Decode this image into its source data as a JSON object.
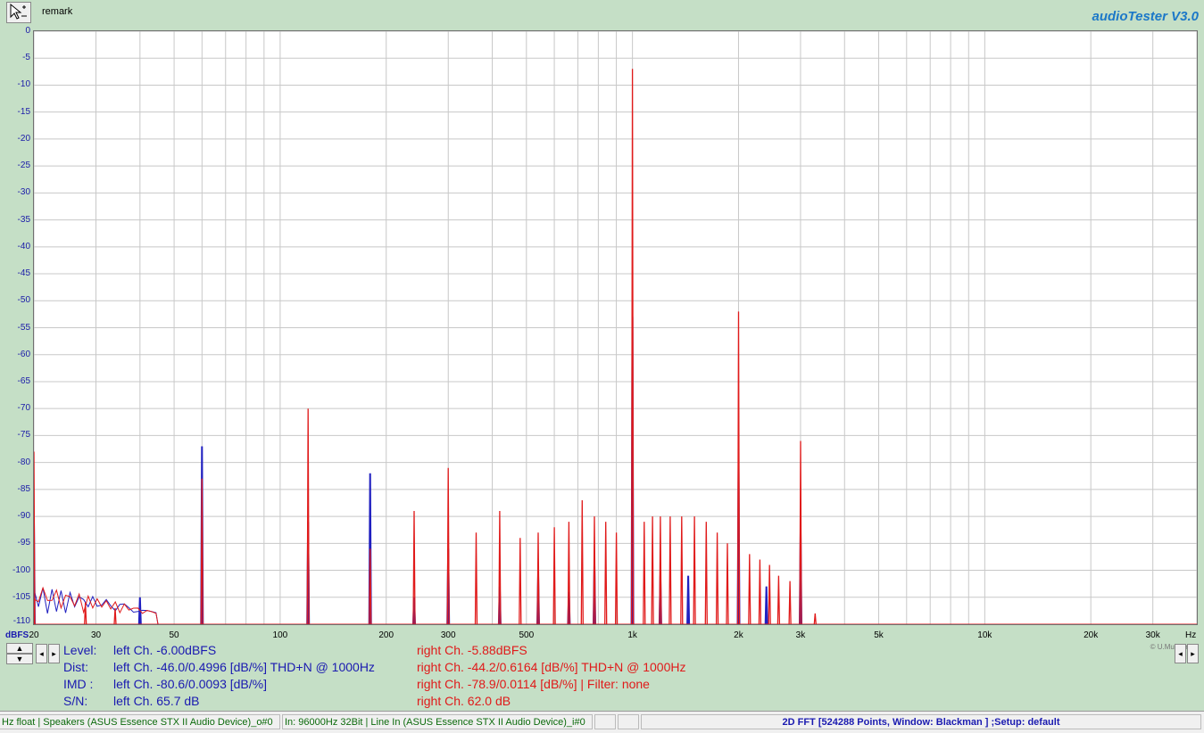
{
  "header": {
    "remark": "remark",
    "brand": "audioTester  V3.0"
  },
  "plot": {
    "copyright": "© U.Mueller",
    "y_unit": "dBFS",
    "x_unit": "Hz"
  },
  "chart_data": {
    "type": "line",
    "title": "",
    "xlabel": "Hz",
    "ylabel": "dBFS",
    "x_scale": "log",
    "xlim": [
      20,
      40000
    ],
    "ylim": [
      -110,
      0
    ],
    "y_ticks": [
      "0",
      "-5",
      "-10",
      "-15",
      "-20",
      "-25",
      "-30",
      "-35",
      "-40",
      "-45",
      "-50",
      "-55",
      "-60",
      "-65",
      "-70",
      "-75",
      "-80",
      "-85",
      "-90",
      "-95",
      "-100",
      "-105",
      "-110"
    ],
    "x_ticks": [
      {
        "v": 20,
        "label": "20"
      },
      {
        "v": 30,
        "label": "30"
      },
      {
        "v": 50,
        "label": "50"
      },
      {
        "v": 100,
        "label": "100"
      },
      {
        "v": 200,
        "label": "200"
      },
      {
        "v": 300,
        "label": "300"
      },
      {
        "v": 500,
        "label": "500"
      },
      {
        "v": 1000,
        "label": "1k"
      },
      {
        "v": 2000,
        "label": "2k"
      },
      {
        "v": 3000,
        "label": "3k"
      },
      {
        "v": 5000,
        "label": "5k"
      },
      {
        "v": 10000,
        "label": "10k"
      },
      {
        "v": 20000,
        "label": "20k"
      },
      {
        "v": 30000,
        "label": "30k"
      }
    ],
    "grid": true,
    "series": [
      {
        "color": "#2020c0",
        "peaks": [
          [
            20,
            -91
          ],
          [
            40,
            -105
          ],
          [
            60,
            -77
          ],
          [
            120,
            -91
          ],
          [
            180,
            -82
          ],
          [
            240,
            -105
          ],
          [
            300,
            -96
          ],
          [
            420,
            -103
          ],
          [
            540,
            -101
          ],
          [
            660,
            -104
          ],
          [
            780,
            -99
          ],
          [
            1000,
            -53
          ],
          [
            1200,
            -101
          ],
          [
            1440,
            -101
          ],
          [
            2000,
            -81
          ],
          [
            2400,
            -103
          ],
          [
            3000,
            -93
          ]
        ]
      },
      {
        "color": "#e01a1a",
        "peaks": [
          [
            20,
            -78
          ],
          [
            28,
            -106
          ],
          [
            34,
            -107
          ],
          [
            60,
            -83
          ],
          [
            120,
            -70
          ],
          [
            180,
            -96
          ],
          [
            240,
            -89
          ],
          [
            300,
            -81
          ],
          [
            360,
            -93
          ],
          [
            420,
            -89
          ],
          [
            480,
            -94
          ],
          [
            540,
            -93
          ],
          [
            600,
            -92
          ],
          [
            660,
            -91
          ],
          [
            720,
            -87
          ],
          [
            780,
            -90
          ],
          [
            840,
            -91
          ],
          [
            900,
            -93
          ],
          [
            1000,
            -7
          ],
          [
            1080,
            -91
          ],
          [
            1140,
            -90
          ],
          [
            1200,
            -90
          ],
          [
            1280,
            -90
          ],
          [
            1380,
            -90
          ],
          [
            1500,
            -90
          ],
          [
            1620,
            -91
          ],
          [
            1740,
            -93
          ],
          [
            1860,
            -95
          ],
          [
            2000,
            -52
          ],
          [
            2150,
            -97
          ],
          [
            2300,
            -98
          ],
          [
            2450,
            -99
          ],
          [
            2600,
            -101
          ],
          [
            2800,
            -102
          ],
          [
            3000,
            -76
          ],
          [
            3300,
            -108
          ]
        ]
      }
    ]
  },
  "measurements": {
    "labels": [
      "Level:",
      "Dist:",
      "IMD  :",
      "S/N:"
    ],
    "left": [
      "left Ch. -6.00dBFS",
      "left Ch. -46.0/0.4996 [dB/%] THD+N  @ 1000Hz",
      "left Ch. -80.6/0.0093 [dB/%]",
      "left Ch. 65.7 dB"
    ],
    "right": [
      "right Ch. -5.88dBFS",
      "right Ch. -44.2/0.6164 [dB/%] THD+N  @ 1000Hz",
      "right Ch. -78.9/0.0114 [dB/%] |   Filter: none",
      "right Ch. 62.0 dB"
    ]
  },
  "statusbar": {
    "output": "Hz float  | Speakers (ASUS Essence STX II Audio Device)_o#0",
    "input": "In: 96000Hz 32Bit  | Line In (ASUS Essence STX II Audio Device)_i#0",
    "main": "2D FFT [524288 Points, Window: Blackman ]  ;Setup:  default"
  },
  "colors": {
    "background": "#c5dfc6",
    "left_channel": "#1a1ab0",
    "right_channel": "#e01a1a",
    "brand": "#1c78c8"
  }
}
